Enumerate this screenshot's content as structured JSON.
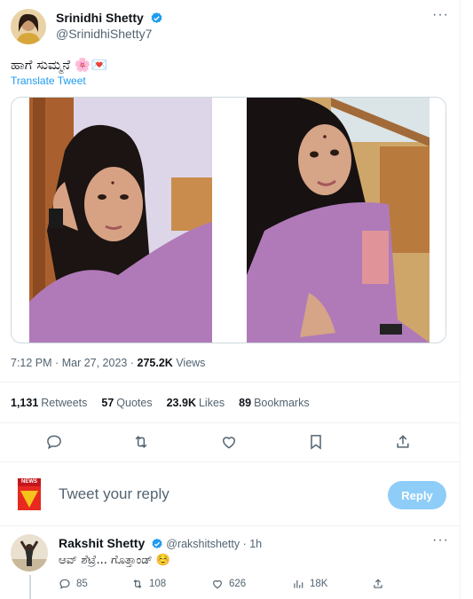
{
  "tweet": {
    "author_name": "Srinidhi Shetty",
    "author_handle": "@SrinidhiShetty7",
    "text": "ಹಾಗೆ ಸುಮ್ಮನೆ 🌸💌",
    "translate_label": "Translate Tweet",
    "time": "7:12 PM",
    "date": "Mar 27, 2023",
    "views_count": "275.2K",
    "views_label": "Views",
    "separator": "·"
  },
  "stats": [
    {
      "count": "1,131",
      "label": "Retweets"
    },
    {
      "count": "57",
      "label": "Quotes"
    },
    {
      "count": "23.9K",
      "label": "Likes"
    },
    {
      "count": "89",
      "label": "Bookmarks"
    }
  ],
  "composer": {
    "placeholder": "Tweet your reply",
    "button_label": "Reply",
    "avatar_text": "NEWS"
  },
  "reply": {
    "author_name": "Rakshit Shetty",
    "author_handle": "@rakshitshetty",
    "time": "1h",
    "text": "ಆವ್ ಶೆಟ್ರೆ... ಗೊತ್ತಾಂಡ್ ☺️",
    "replies": "85",
    "retweets": "108",
    "likes": "626",
    "views": "18K"
  },
  "colors": {
    "accent": "#1d9bf0",
    "secondary_text": "#536471",
    "reply_button": "#8ecdf8",
    "dress": "#b07ab9"
  },
  "icons": [
    "verified-icon",
    "more-icon",
    "reply-icon",
    "retweet-icon",
    "like-icon",
    "bookmark-icon",
    "share-icon",
    "views-icon"
  ]
}
